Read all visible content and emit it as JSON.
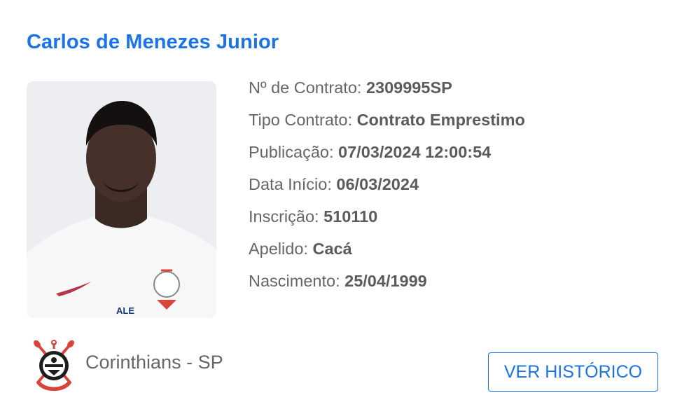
{
  "player": {
    "name": "Carlos de Menezes Junior",
    "photo": "player-photo",
    "details": [
      {
        "label": "Nº de Contrato:",
        "value": "2309995SP"
      },
      {
        "label": "Tipo Contrato:",
        "value": "Contrato Emprestimo"
      },
      {
        "label": "Publicação:",
        "value": "07/03/2024 12:00:54"
      },
      {
        "label": "Data Início:",
        "value": "06/03/2024"
      },
      {
        "label": "Inscrição:",
        "value": "510110"
      },
      {
        "label": "Apelido:",
        "value": "Cacá"
      },
      {
        "label": "Nascimento:",
        "value": "25/04/1999"
      }
    ]
  },
  "club": {
    "name": "Corinthians - SP",
    "crest_icon": "corinthians-crest-icon"
  },
  "actions": {
    "history_button": "VER HISTÓRICO"
  },
  "colors": {
    "accent": "#1a73e8",
    "text": "#666666",
    "crest_red": "#d6443b"
  }
}
